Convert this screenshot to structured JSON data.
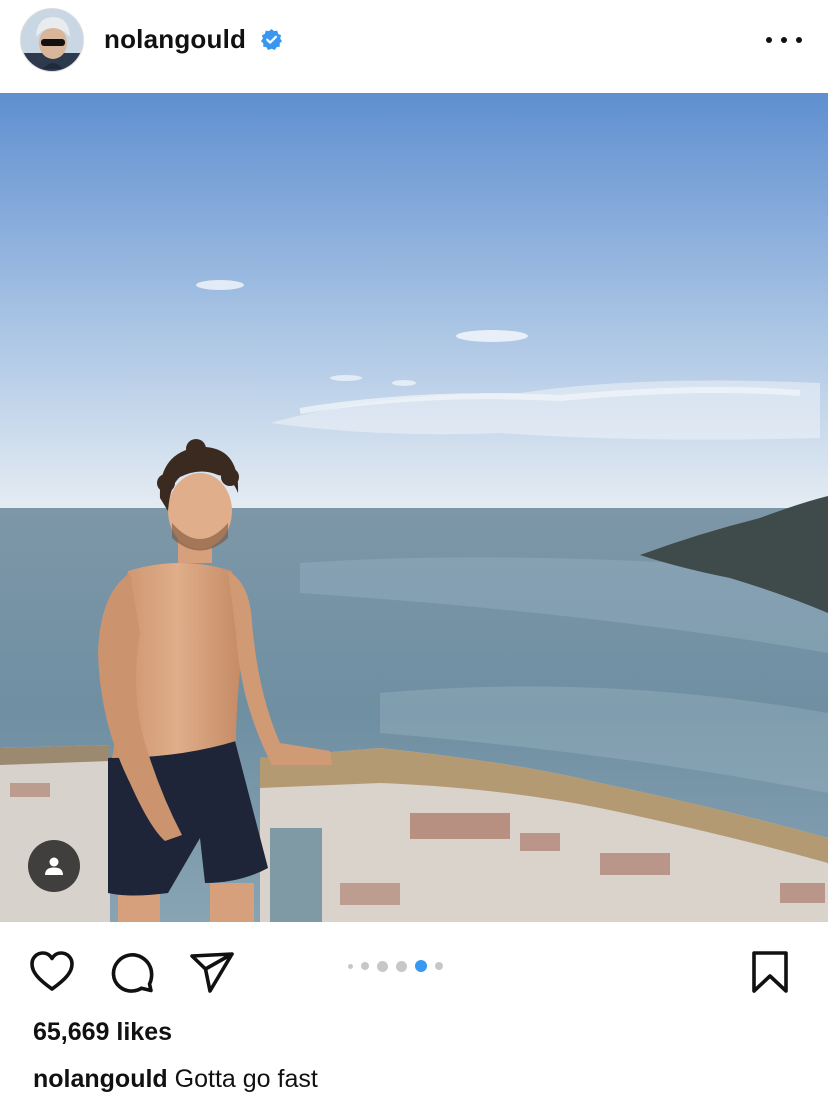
{
  "post": {
    "username": "nolangould",
    "verified": true,
    "likes_text": "65,669 likes",
    "caption_user": "nolangould",
    "caption_text": "Gotta go fast",
    "carousel": {
      "total": 6,
      "active_index": 4
    }
  },
  "icons": {
    "verified": "verified-badge-icon",
    "more": "more-options-icon",
    "like": "heart-icon",
    "comment": "comment-bubble-icon",
    "share": "paper-plane-icon",
    "save": "bookmark-icon",
    "tags": "user-tag-icon"
  },
  "colors": {
    "accent": "#3897f0",
    "verified": "#3897f0",
    "inactive_dot": "#c7c7c7"
  }
}
